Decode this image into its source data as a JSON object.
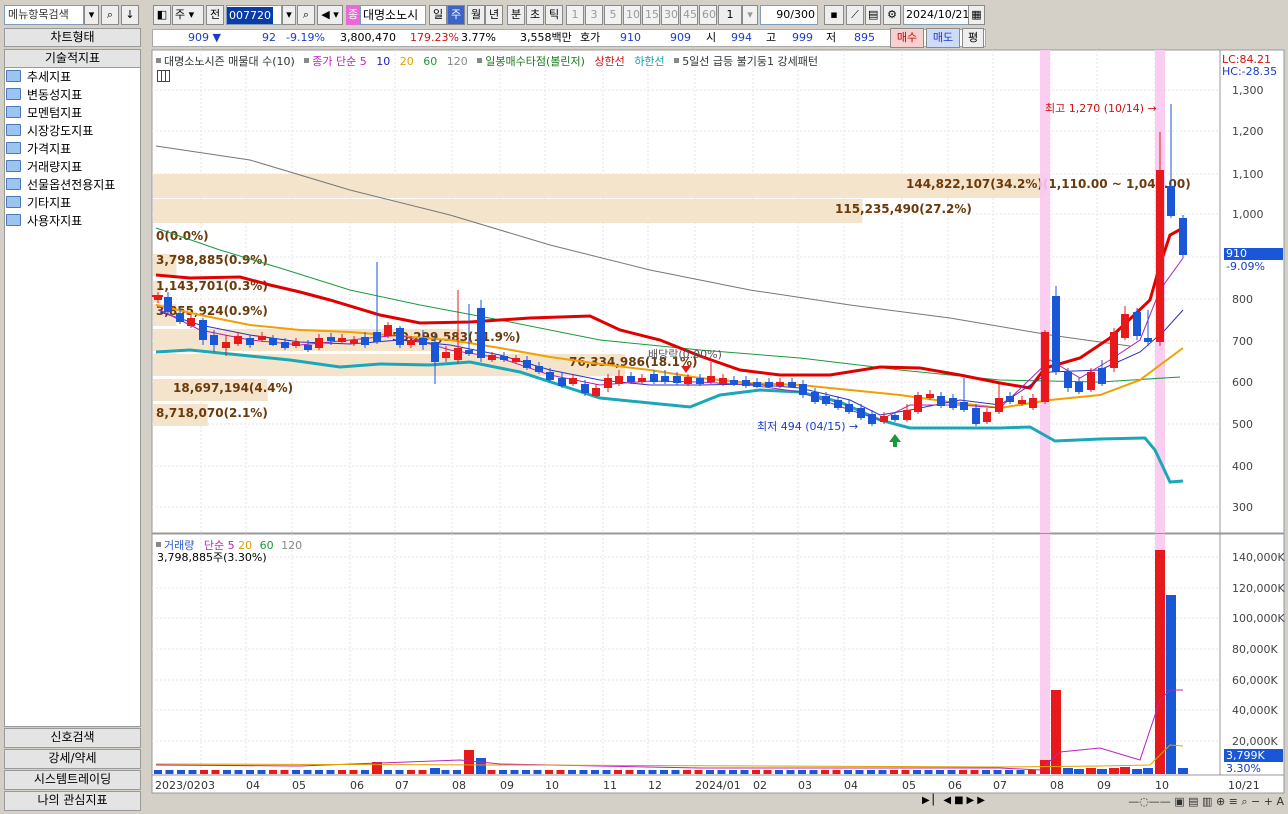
{
  "toolbar": {
    "menu_search": "메뉴항목검색",
    "period_select": "주",
    "prev_label": "전",
    "code": "007720",
    "stock_badge": "종",
    "stock_name": "대명소노시",
    "period_buttons": [
      "일",
      "주",
      "월",
      "년",
      "분",
      "초",
      "틱"
    ],
    "interval_buttons": [
      "1",
      "3",
      "5",
      "10",
      "15",
      "30",
      "45",
      "60"
    ],
    "custom_interval": "1",
    "count_value": "90",
    "count_total": "/300",
    "date": "2024/10/21"
  },
  "quote": {
    "price": "909 ▼",
    "change": "92",
    "change_rate": "-9.19%",
    "volume": "3,800,470",
    "volume_rate": "179.23%",
    "turnover_rate": "3.77%",
    "amount": "3,558백만",
    "ask_label": "호가",
    "ask": "910",
    "bid": "909",
    "open_label": "시",
    "open": "994",
    "high_label": "고",
    "high": "999",
    "low_label": "저",
    "low": "895",
    "buy_btn": "매수",
    "sell_btn": "매도",
    "eval_btn": "평"
  },
  "sidebar": {
    "chart_type": "차트형태",
    "tech_indicators": "기술적지표",
    "items": [
      "추세지표",
      "변동성지표",
      "모멘텀지표",
      "시장강도지표",
      "가격지표",
      "거래량지표",
      "선물옵션전용지표",
      "기타지표",
      "사용자지표"
    ],
    "bottom": [
      "신호검색",
      "강세/약세",
      "시스템트레이딩",
      "나의 관심지표"
    ]
  },
  "price_legend": {
    "stock": "대명소노시즌 매물대 수(10)",
    "close": "종가 단순",
    "ma_periods": [
      "5",
      "10",
      "20",
      "60",
      "120"
    ],
    "ilmok": "일봉매수타점(볼린저)",
    "upper": "상한선",
    "lower": "하한선",
    "pattern": "5일선 급등 불기둥1 강세패턴"
  },
  "volume_legend": {
    "name": "거래량",
    "simple": "단순",
    "periods": [
      "5",
      "20",
      "60",
      "120"
    ],
    "value": "3,798,885주(3.30%)"
  },
  "annotations": {
    "high": "최고 1,270 (10/14)",
    "low": "최저 494 (04/15)",
    "dividend": "배당락(0.00%)",
    "lc": "LC:84.21",
    "hc": "HC:-28.35",
    "price_tag": "910",
    "price_tag_rate": "-9.09%",
    "vol_tag": "3,799K",
    "vol_tag_rate": "3.30%"
  },
  "volume_profile": [
    {
      "price_label": "144,822,107(34.2%)(1,110.00 ~ 1,049.00)",
      "pct": 34.2
    },
    {
      "price_label": "115,235,490(27.2%)",
      "pct": 27.2
    },
    {
      "price_label": "0(0.0%)",
      "pct": 0
    },
    {
      "price_label": "3,798,885(0.9%)",
      "pct": 0.9
    },
    {
      "price_label": "1,143,701(0.3%)",
      "pct": 0.3
    },
    {
      "price_label": "3,855,924(0.9%)",
      "pct": 0.9
    },
    {
      "price_label": "50,299,583(11.9%)",
      "pct": 11.9
    },
    {
      "price_label": "76,334,986(18.1%)",
      "pct": 18.1
    },
    {
      "price_label": "18,697,194(4.4%)",
      "pct": 4.4
    },
    {
      "price_label": "8,718,070(2.1%)",
      "pct": 2.1
    }
  ],
  "y_axis_price": [
    "1,300",
    "1,200",
    "1,100",
    "1,000",
    "800",
    "700",
    "600",
    "500",
    "400",
    "300"
  ],
  "y_axis_volume": [
    "140,000K",
    "120,000K",
    "100,000K",
    "80,000K",
    "60,000K",
    "40,000K",
    "20,000K"
  ],
  "x_axis": [
    "2023/02",
    "03",
    "04",
    "05",
    "06",
    "07",
    "08",
    "09",
    "10",
    "11",
    "12",
    "2024/01",
    "02",
    "03",
    "04",
    "05",
    "06",
    "07",
    "08",
    "09",
    "10",
    "10/21"
  ],
  "colors": {
    "up": "#e8191b",
    "down": "#1a57d6",
    "bollinger_upper": "#e10000",
    "bollinger_lower": "#1aa8b8",
    "ma20": "#f0a000",
    "ma60": "#1a9a3a",
    "ma120": "#777777",
    "profile": "#f5e4cc",
    "highlight": "#f9c8f0"
  }
}
